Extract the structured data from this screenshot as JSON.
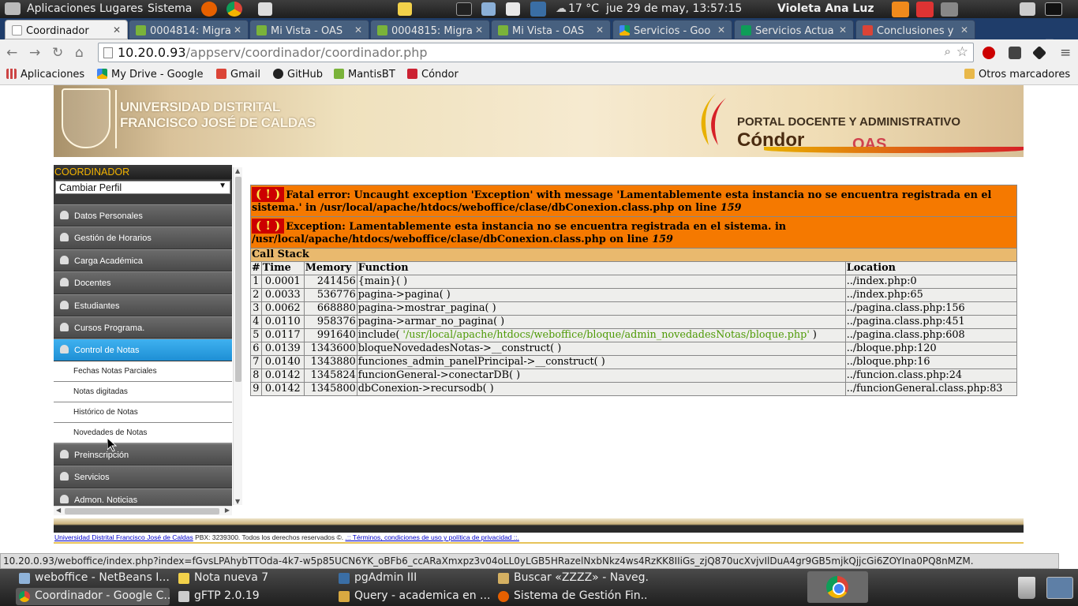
{
  "topbar": {
    "menus": [
      "Aplicaciones",
      "Lugares",
      "Sistema"
    ],
    "weather": "17 °C",
    "clock": "jue 29 de may, 13:57:15",
    "user": "Violeta Ana Luz"
  },
  "tabs": [
    {
      "label": "Coordinador",
      "active": true
    },
    {
      "label": "0004814: Migra"
    },
    {
      "label": "Mi Vista - OAS"
    },
    {
      "label": "0004815: Migra"
    },
    {
      "label": "Mi Vista - OAS"
    },
    {
      "label": "Servicios - Goo"
    },
    {
      "label": "Servicios Actua"
    },
    {
      "label": "Conclusiones y"
    }
  ],
  "address": {
    "host": "10.20.0.93",
    "path": "/appserv/coordinador/coordinador.php"
  },
  "bookmarks": {
    "items": [
      "Aplicaciones",
      "My Drive - Google",
      "Gmail",
      "GitHub",
      "MantisBT",
      "Cóndor"
    ],
    "other": "Otros marcadores"
  },
  "banner": {
    "university_line1": "UNIVERSIDAD DISTRITAL",
    "university_line2": "FRANCISCO JOSÉ DE CALDAS",
    "portal": "PORTAL DOCENTE Y ADMINISTRATIVO",
    "brand": "Cóndor",
    "oas": "OAS"
  },
  "sidebar": {
    "title": "COORDINADOR",
    "profile_select": "Cambiar Perfil",
    "items_top": [
      "Datos Personales",
      "Gestión de Horarios",
      "Carga Académica",
      "Docentes",
      "Estudiantes",
      "Cursos Programa."
    ],
    "active_item": "Control de Notas",
    "subitems": [
      "Fechas Notas Parciales",
      "Notas digitadas",
      "Histórico de Notas",
      "Novedades de Notas"
    ],
    "items_bottom": [
      "Preinscripción",
      "Servicios",
      "Admon. Noticias"
    ]
  },
  "error": {
    "bang": "( ! )",
    "fatal": "Fatal error: Uncaught exception 'Exception' with message 'Lamentablemente esta instancia no se encuentra registrada en el sistema.' in /usr/local/apache/htdocs/weboffice/clase/dbConexion.class.php on line ",
    "fatal_line": "159",
    "exception": "Exception: Lamentablemente esta instancia no se encuentra registrada en el sistema. in /usr/local/apache/htdocs/weboffice/clase/dbConexion.class.php on line ",
    "exception_line": "159",
    "call_stack": "Call Stack",
    "headers": [
      "#",
      "Time",
      "Memory",
      "Function",
      "Location"
    ],
    "rows": [
      {
        "n": "1",
        "time": "0.0001",
        "memory": "241456",
        "function": "{main}( )",
        "arg": "",
        "location": "../index.php:0"
      },
      {
        "n": "2",
        "time": "0.0033",
        "memory": "536776",
        "function": "pagina->pagina( )",
        "arg": "",
        "location": "../index.php:65"
      },
      {
        "n": "3",
        "time": "0.0062",
        "memory": "668880",
        "function": "pagina->mostrar_pagina( )",
        "arg": "",
        "location": "../pagina.class.php:156"
      },
      {
        "n": "4",
        "time": "0.0110",
        "memory": "958376",
        "function": "pagina->armar_no_pagina( )",
        "arg": "",
        "location": "../pagina.class.php:451"
      },
      {
        "n": "5",
        "time": "0.0117",
        "memory": "991640",
        "function": "include( ",
        "arg": "'/usr/local/apache/htdocs/weboffice/bloque/admin_novedadesNotas/bloque.php'",
        "location": "../pagina.class.php:608"
      },
      {
        "n": "6",
        "time": "0.0139",
        "memory": "1343600",
        "function": "bloqueNovedadesNotas->__construct( )",
        "arg": "",
        "location": "../bloque.php:120"
      },
      {
        "n": "7",
        "time": "0.0140",
        "memory": "1343880",
        "function": "funciones_admin_panelPrincipal->__construct( )",
        "arg": "",
        "location": "../bloque.php:16"
      },
      {
        "n": "8",
        "time": "0.0142",
        "memory": "1345824",
        "function": "funcionGeneral->conectarDB( )",
        "arg": "",
        "location": "../funcion.class.php:24"
      },
      {
        "n": "9",
        "time": "0.0142",
        "memory": "1345800",
        "function": "dbConexion->recursodb( )",
        "arg": "",
        "location": "../funcionGeneral.class.php:83"
      }
    ]
  },
  "footer": {
    "university_link": "Universidad Distrital Francisco José de Caldas",
    "text": " PBX: 3239300. Todos los derechos reservados ©. ",
    "terms_link": ".:: Términos, condiciones de uso y política de privacidad ::."
  },
  "status_url": "10.20.0.93/weboffice/index.php?index=fGvsLPAhybTTOda-4k7-w5p85UCN6YK_oBFb6_ccARaXmxpz3v04oLL0yLGB5HRazelNxbNkz4ws4RzKK8IIiGs_zjQ870ucXvjvIlDuA4gr9GB5mjkQjjcGi6ZOYIna0PQ8nMZM.",
  "taskbar": {
    "row1": [
      "weboffice - NetBeans I...",
      "Nota nueva 7",
      "pgAdmin III",
      "Buscar «ZZZZ» - Naveg..."
    ],
    "row2": [
      "Coordinador - Google C...",
      "gFTP 2.0.19",
      "Query - academica en ...",
      "Sistema de Gestión Fin..."
    ]
  },
  "colors": {
    "fatal_bg": "#f57900",
    "callstack_bg": "#e9b96e",
    "active_menu": "#2a9fe3",
    "tab_strip": "#1f3d6a"
  }
}
